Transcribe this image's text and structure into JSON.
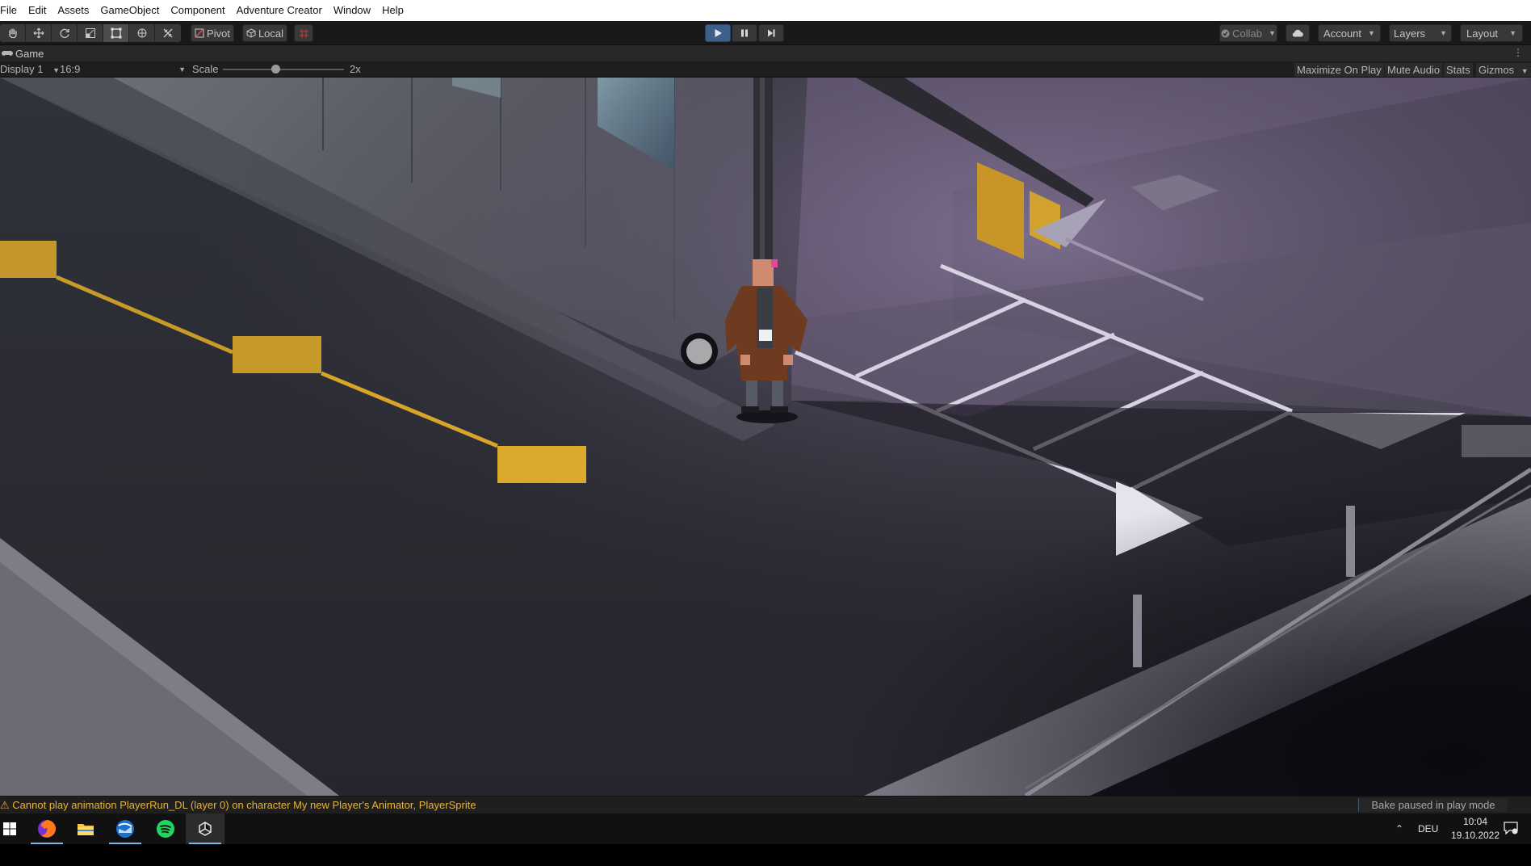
{
  "menu": [
    "File",
    "Edit",
    "Assets",
    "GameObject",
    "Component",
    "Adventure Creator",
    "Window",
    "Help"
  ],
  "toolbar": {
    "tools": [
      "hand-tool-icon",
      "move-tool-icon",
      "rotate-tool-icon",
      "scale-tool-icon",
      "rect-tool-icon",
      "transform-tool-icon",
      "custom-tool-icon"
    ],
    "pivot_label": "Pivot",
    "local_label": "Local",
    "collab_label": "Collab",
    "account_label": "Account",
    "layers_label": "Layers",
    "layout_label": "Layout"
  },
  "game_tab": {
    "title": "Game"
  },
  "game_controls": {
    "display": "Display 1",
    "aspect": "16:9",
    "scale_label": "Scale",
    "scale_value": "2x",
    "maximize_label": "Maximize On Play",
    "mute_label": "Mute Audio",
    "stats_label": "Stats",
    "gizmos_label": "Gizmos"
  },
  "status": {
    "message": "Cannot play animation PlayerRun_DL (layer 0) on character My new Player's Animator, PlayerSprite",
    "bake": "Bake paused in play mode"
  },
  "taskbar": {
    "apps": [
      "windows-start-icon",
      "firefox-icon",
      "file-explorer-icon",
      "thunderbird-icon",
      "spotify-icon",
      "unity-icon"
    ],
    "language": "DEU",
    "time": "10:04",
    "date": "19.10.2022"
  },
  "colors": {
    "play_active": "#3d5f8a",
    "warning": "#e7b33c",
    "road_marking_yellow": "#d9a42a",
    "editor_dark": "#191919"
  }
}
